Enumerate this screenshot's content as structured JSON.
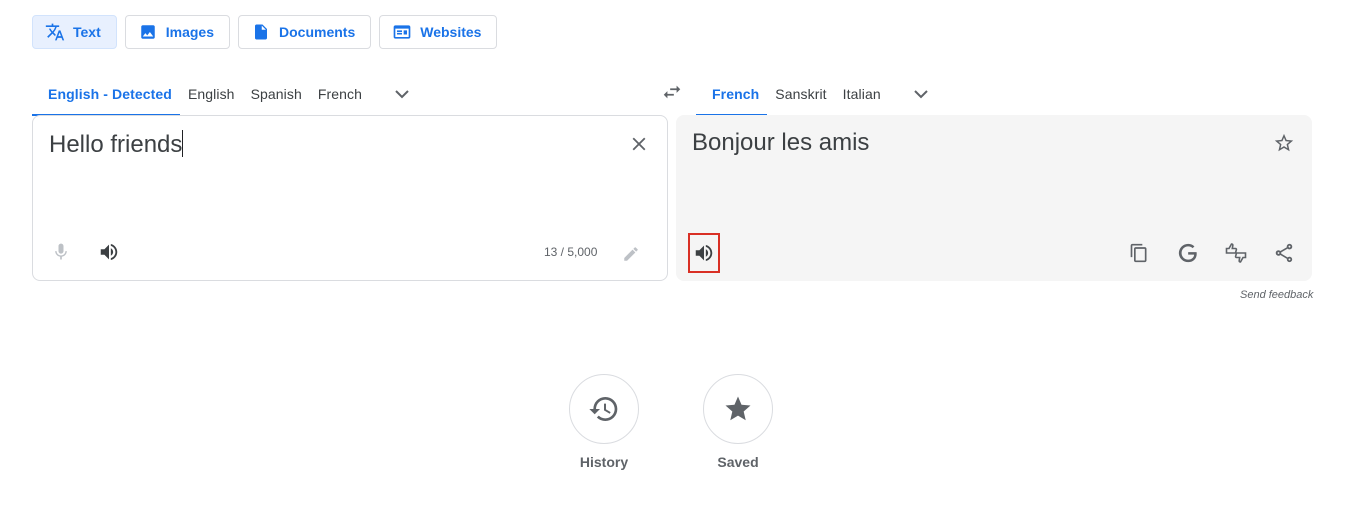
{
  "modes": [
    {
      "label": "Text",
      "icon": "translate-icon",
      "active": true
    },
    {
      "label": "Images",
      "icon": "image-icon",
      "active": false
    },
    {
      "label": "Documents",
      "icon": "document-icon",
      "active": false
    },
    {
      "label": "Websites",
      "icon": "website-icon",
      "active": false
    }
  ],
  "source_languages": [
    "English - Detected",
    "English",
    "Spanish",
    "French"
  ],
  "target_languages": [
    "French",
    "Sanskrit",
    "Italian"
  ],
  "source": {
    "text": "Hello friends",
    "counter": "13 / 5,000"
  },
  "target": {
    "text": "Bonjour les amis"
  },
  "send_feedback": "Send feedback",
  "quick_actions": [
    {
      "label": "History",
      "icon": "history-icon"
    },
    {
      "label": "Saved",
      "icon": "star-filled-icon"
    }
  ],
  "colors": {
    "accent": "#1a73e8",
    "icon": "#5f6368",
    "highlight": "#d93025",
    "target_bg": "#f5f5f5"
  }
}
